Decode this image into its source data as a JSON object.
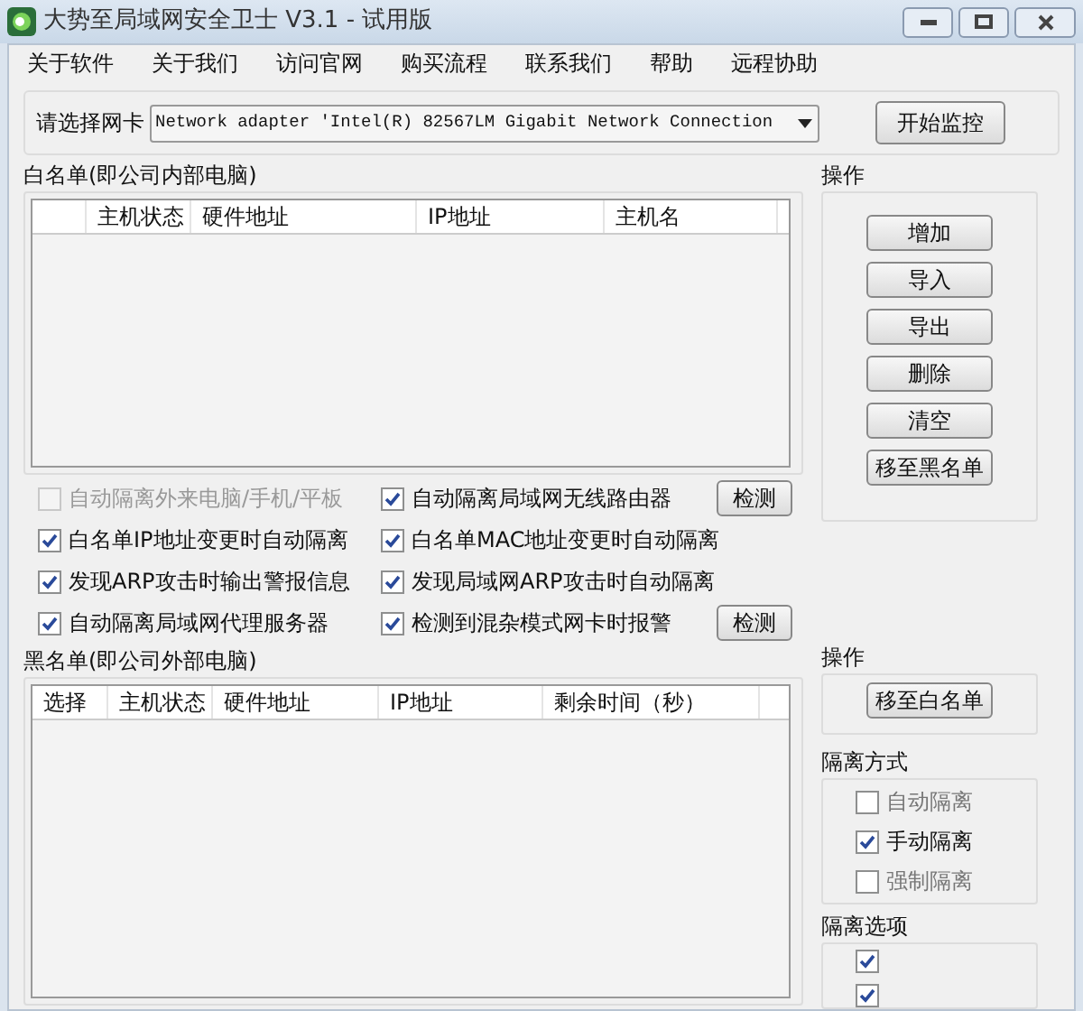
{
  "window": {
    "title": "大势至局域网安全卫士 V3.1 - 试用版"
  },
  "menu": [
    "关于软件",
    "关于我们",
    "访问官网",
    "购买流程",
    "联系我们",
    "帮助",
    "远程协助"
  ],
  "adapter": {
    "label": "请选择网卡",
    "value": "Network adapter 'Intel(R) 82567LM Gigabit Network Connection",
    "button": "开始监控"
  },
  "whitelist": {
    "title": "白名单(即公司内部电脑)",
    "columns": [
      "",
      "主机状态",
      "硬件地址",
      "IP地址",
      "主机名"
    ]
  },
  "whitelist_actions": {
    "title": "操作",
    "buttons": [
      "增加",
      "导入",
      "导出",
      "删除",
      "清空",
      "移至黑名单"
    ]
  },
  "options": [
    {
      "label": "自动隔离外来电脑/手机/平板",
      "checked": false,
      "disabled": true
    },
    {
      "label": "自动隔离局域网无线路由器",
      "checked": true,
      "disabled": false,
      "button": "检测"
    },
    {
      "label": "白名单IP地址变更时自动隔离",
      "checked": true,
      "disabled": false
    },
    {
      "label": "白名单MAC地址变更时自动隔离",
      "checked": true,
      "disabled": false
    },
    {
      "label": "发现ARP攻击时输出警报信息",
      "checked": true,
      "disabled": false
    },
    {
      "label": "发现局域网ARP攻击时自动隔离",
      "checked": true,
      "disabled": false
    },
    {
      "label": "自动隔离局域网代理服务器",
      "checked": true,
      "disabled": false
    },
    {
      "label": "检测到混杂模式网卡时报警",
      "checked": true,
      "disabled": false,
      "button": "检测"
    }
  ],
  "blacklist": {
    "title": "黑名单(即公司外部电脑)",
    "columns": [
      "选择",
      "主机状态",
      "硬件地址",
      "IP地址",
      "剩余时间（秒）"
    ]
  },
  "blacklist_actions": {
    "title": "操作",
    "buttons": [
      "移至白名单"
    ]
  },
  "isolation_mode": {
    "title": "隔离方式",
    "items": [
      {
        "label": "自动隔离",
        "checked": false
      },
      {
        "label": "手动隔离",
        "checked": true
      },
      {
        "label": "强制隔离",
        "checked": false
      }
    ]
  },
  "isolation_options": {
    "title": "隔离选项",
    "items": [
      {
        "checked": true
      },
      {
        "checked": true
      }
    ]
  }
}
